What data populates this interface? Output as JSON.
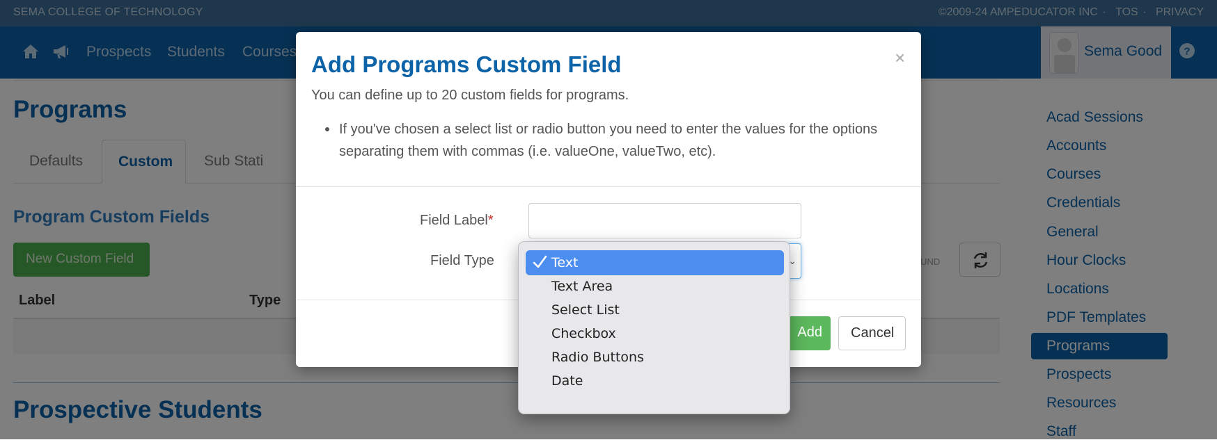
{
  "topbar": {
    "school": "SEMA COLLEGE OF TECHNOLOGY",
    "copyright": "©2009-24 AMPEDUCATOR INC",
    "tos": "TOS",
    "privacy": "PRIVACY",
    "separator": "·"
  },
  "nav": {
    "home_icon": "home-icon",
    "announce_icon": "megaphone-icon",
    "links": [
      "Prospects",
      "Students",
      "Courses"
    ],
    "user_name": "Sema Good",
    "help_icon": "help-icon"
  },
  "page": {
    "title": "Programs",
    "tabs": [
      "Defaults",
      "Custom",
      "Sub Stati"
    ],
    "active_tab": "Custom",
    "section_title": "Program Custom Fields",
    "new_button": "New Custom Field",
    "found_text": "OUND",
    "columns": [
      "Label",
      "Type"
    ],
    "section_title2": "Prospective Students"
  },
  "sidebar": {
    "items": [
      "Acad Sessions",
      "Accounts",
      "Courses",
      "Credentials",
      "General",
      "Hour Clocks",
      "Locations",
      "PDF Templates",
      "Programs",
      "Prospects",
      "Resources",
      "Staff"
    ],
    "active": "Programs"
  },
  "modal": {
    "title": "Add Programs Custom Field",
    "close": "×",
    "description": "You can define up to 20 custom fields for programs.",
    "bullet": "If you've chosen a select list or radio button you need to enter the values for the options separating them with commas (i.e. valueOne, valueTwo, etc).",
    "field_label": "Field Label",
    "required_mark": "*",
    "field_type": "Field Type",
    "field_label_value": "",
    "add_button": "Add",
    "cancel_button": "Cancel"
  },
  "dropdown": {
    "options": [
      "Text",
      "Text Area",
      "Select List",
      "Checkbox",
      "Radio Buttons",
      "Date"
    ],
    "selected": "Text",
    "colors": {
      "selected_bg": "#4c8ef0",
      "menu_bg": "#e8e8eb"
    }
  },
  "colors": {
    "brand": "#0c63a8",
    "topbar": "#3d6e98",
    "success": "#5cb85c"
  }
}
